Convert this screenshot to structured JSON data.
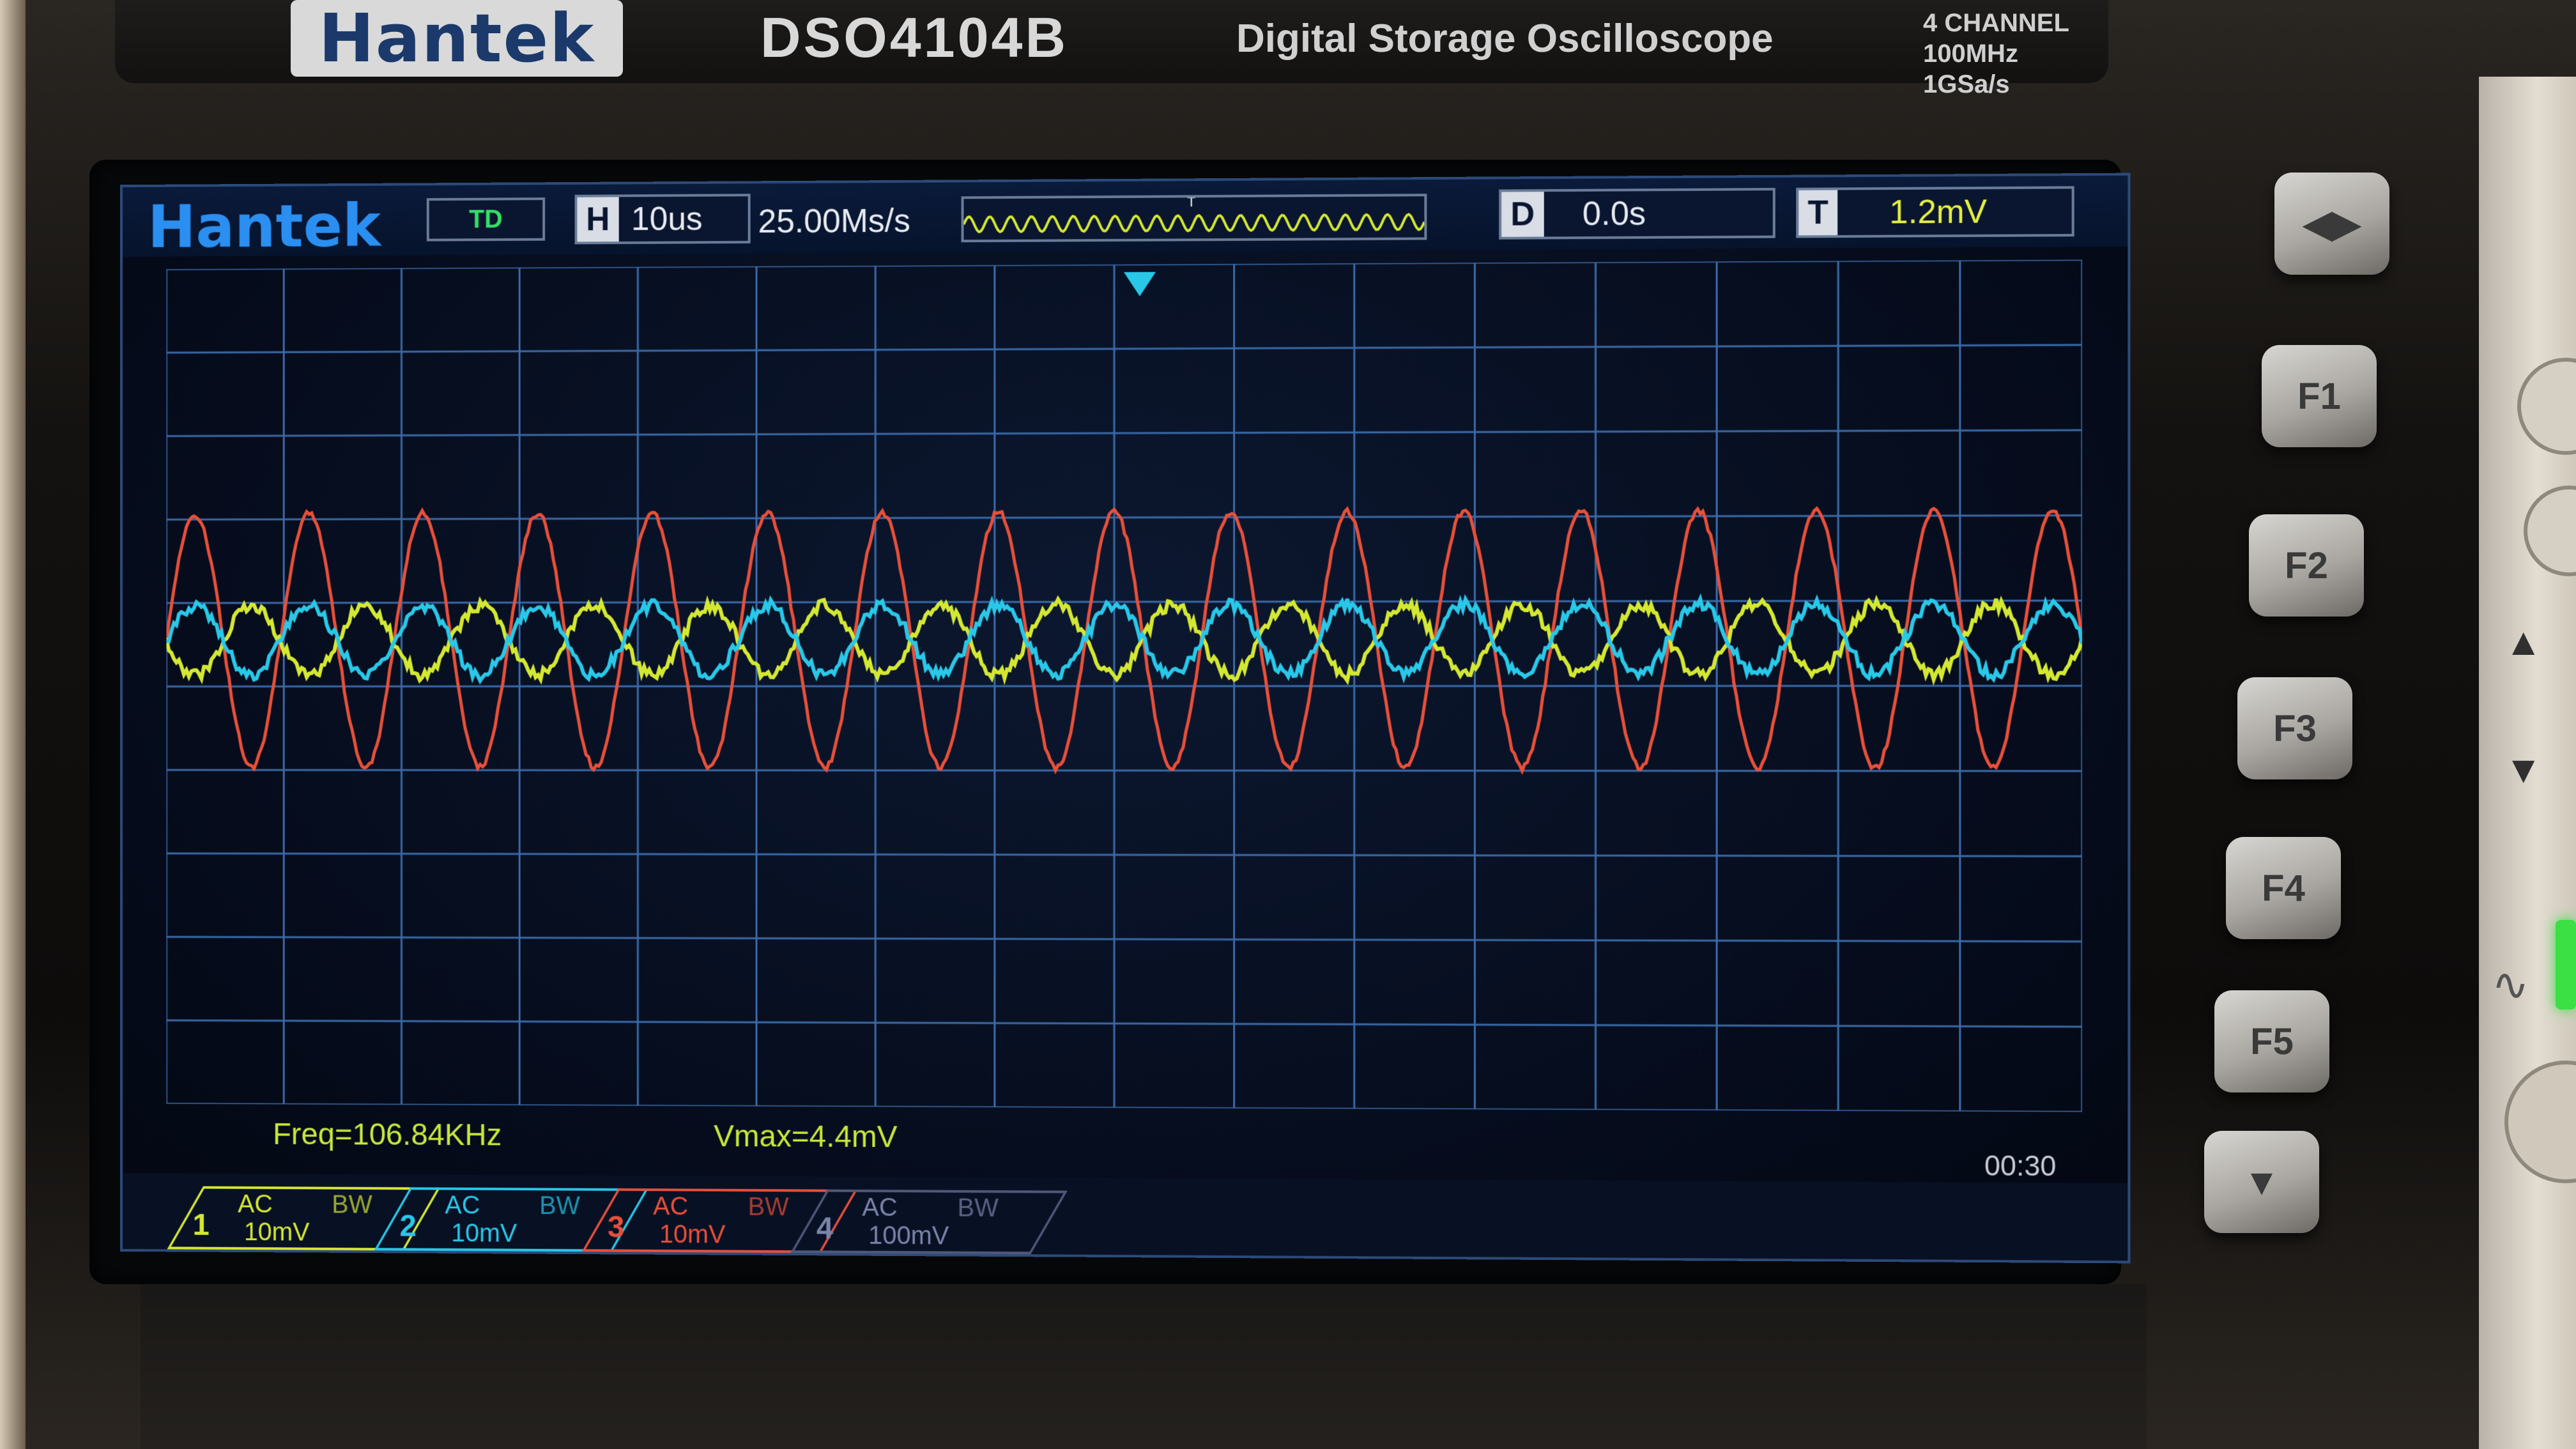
{
  "device": {
    "brand": "Hantek",
    "model": "DSO4104B",
    "subtitle": "Digital Storage Oscilloscope",
    "channels_line1": "4 CHANNEL",
    "channels_line2": "100MHz 1GSa/s"
  },
  "status_bar": {
    "logo": "Hantek",
    "trigger_status": "TD",
    "horizontal_label": "H",
    "timebase": "10us",
    "sample_rate": "25.00Ms/s",
    "trigger_marker": "T",
    "delay_label": "D",
    "delay": "0.0s",
    "trigger_label": "T",
    "trigger_level": "1.2mV"
  },
  "measurements": {
    "freq": "Freq=106.84KHz",
    "vmax": "Vmax=4.4mV"
  },
  "timer": "00:30",
  "channels": [
    {
      "number": "1",
      "coupling": "AC",
      "bw": "BW",
      "scale": "10mV",
      "color": "#d4e832"
    },
    {
      "number": "2",
      "coupling": "AC",
      "bw": "BW",
      "scale": "10mV",
      "color": "#28c8e8"
    },
    {
      "number": "3",
      "coupling": "AC",
      "bw": "BW",
      "scale": "10mV",
      "color": "#e8503a"
    },
    {
      "number": "4",
      "coupling": "AC",
      "bw": "BW",
      "scale": "100mV",
      "color": "#7a84a8"
    }
  ],
  "softkeys": [
    {
      "label": "◀▶",
      "icon": "toggle-icon"
    },
    {
      "label": "F1"
    },
    {
      "label": "F2"
    },
    {
      "label": "F3"
    },
    {
      "label": "F4"
    },
    {
      "label": "F5"
    },
    {
      "label": "▼",
      "icon": "chevron-down-icon"
    }
  ],
  "colors": {
    "ch1": "#d4e832",
    "ch2": "#28c8e8",
    "ch3": "#e8503a",
    "grid": "#3a6aa8",
    "screen_bg": "#060d1e"
  }
}
